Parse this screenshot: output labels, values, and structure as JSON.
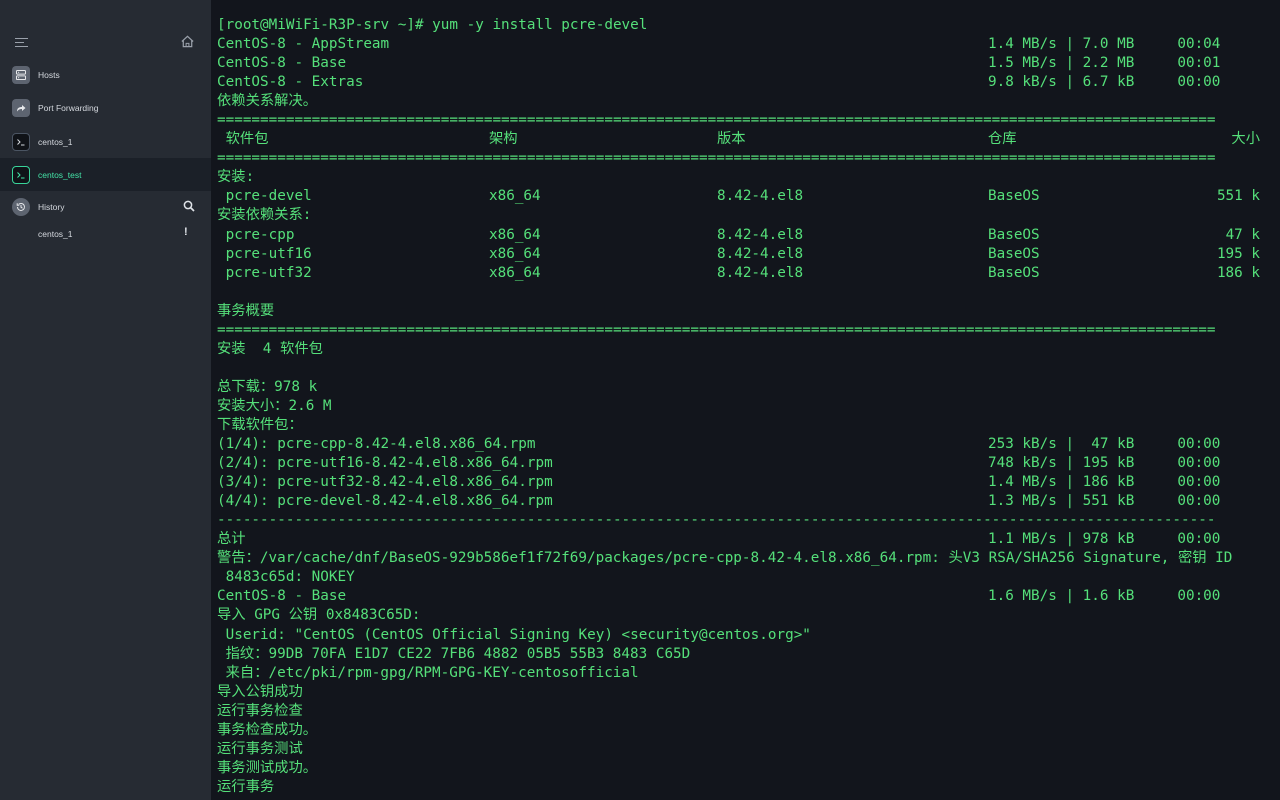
{
  "sidebar": {
    "hosts": "Hosts",
    "port_forwarding": "Port Forwarding",
    "centos_1": "centos_1",
    "centos_test": "centos_test",
    "history": "History",
    "history_item": "centos_1",
    "history_item_alert": "!"
  },
  "terminal": {
    "lines": [
      {
        "l": "[root@MiWiFi-R3P-srv ~]# yum -y install pcre-devel"
      },
      {
        "l": "CentOS-8 - AppStream",
        "r": "1.4 MB/s | 7.0 MB     00:04"
      },
      {
        "l": "CentOS-8 - Base",
        "r": "1.5 MB/s | 2.2 MB     00:01"
      },
      {
        "l": "CentOS-8 - Extras",
        "r": "9.8 kB/s | 6.7 kB     00:00"
      },
      {
        "l": "依赖关系解决。"
      },
      {
        "l": "===================================================================================================================="
      },
      {
        "l": " 软件包",
        "c1": "架构",
        "c2": "版本",
        "c3": "仓库",
        "c4": "大小"
      },
      {
        "l": "===================================================================================================================="
      },
      {
        "l": "安装:"
      },
      {
        "l": " pcre-devel",
        "c1": "x86_64",
        "c2": "8.42-4.el8",
        "c3": "BaseOS",
        "c4": "551 k"
      },
      {
        "l": "安装依赖关系:"
      },
      {
        "l": " pcre-cpp",
        "c1": "x86_64",
        "c2": "8.42-4.el8",
        "c3": "BaseOS",
        "c4": "47 k"
      },
      {
        "l": " pcre-utf16",
        "c1": "x86_64",
        "c2": "8.42-4.el8",
        "c3": "BaseOS",
        "c4": "195 k"
      },
      {
        "l": " pcre-utf32",
        "c1": "x86_64",
        "c2": "8.42-4.el8",
        "c3": "BaseOS",
        "c4": "186 k"
      },
      {
        "l": ""
      },
      {
        "l": "事务概要"
      },
      {
        "l": "===================================================================================================================="
      },
      {
        "l": "安装  4 软件包"
      },
      {
        "l": ""
      },
      {
        "l": "总下载：978 k"
      },
      {
        "l": "安装大小：2.6 M"
      },
      {
        "l": "下载软件包："
      },
      {
        "l": "(1/4): pcre-cpp-8.42-4.el8.x86_64.rpm",
        "r": "253 kB/s |  47 kB     00:00"
      },
      {
        "l": "(2/4): pcre-utf16-8.42-4.el8.x86_64.rpm",
        "r": "748 kB/s | 195 kB     00:00"
      },
      {
        "l": "(3/4): pcre-utf32-8.42-4.el8.x86_64.rpm",
        "r": "1.4 MB/s | 186 kB     00:00"
      },
      {
        "l": "(4/4): pcre-devel-8.42-4.el8.x86_64.rpm",
        "r": "1.3 MB/s | 551 kB     00:00"
      },
      {
        "l": "--------------------------------------------------------------------------------------------------------------------"
      },
      {
        "l": "总计",
        "r": "1.1 MB/s | 978 kB     00:00"
      },
      {
        "l": "警告：/var/cache/dnf/BaseOS-929b586ef1f72f69/packages/pcre-cpp-8.42-4.el8.x86_64.rpm: 头V3 RSA/SHA256 Signature, 密钥 ID"
      },
      {
        "l": " 8483c65d: NOKEY"
      },
      {
        "l": "CentOS-8 - Base",
        "r": "1.6 MB/s | 1.6 kB     00:00"
      },
      {
        "l": "导入 GPG 公钥 0x8483C65D:"
      },
      {
        "l": " Userid: \"CentOS (CentOS Official Signing Key) <security@centos.org>\""
      },
      {
        "l": " 指纹：99DB 70FA E1D7 CE22 7FB6 4882 05B5 55B3 8483 C65D"
      },
      {
        "l": " 来自：/etc/pki/rpm-gpg/RPM-GPG-KEY-centosofficial"
      },
      {
        "l": "导入公钥成功"
      },
      {
        "l": "运行事务检查"
      },
      {
        "l": "事务检查成功。"
      },
      {
        "l": "运行事务测试"
      },
      {
        "l": "事务测试成功。"
      },
      {
        "l": "运行事务"
      }
    ]
  }
}
